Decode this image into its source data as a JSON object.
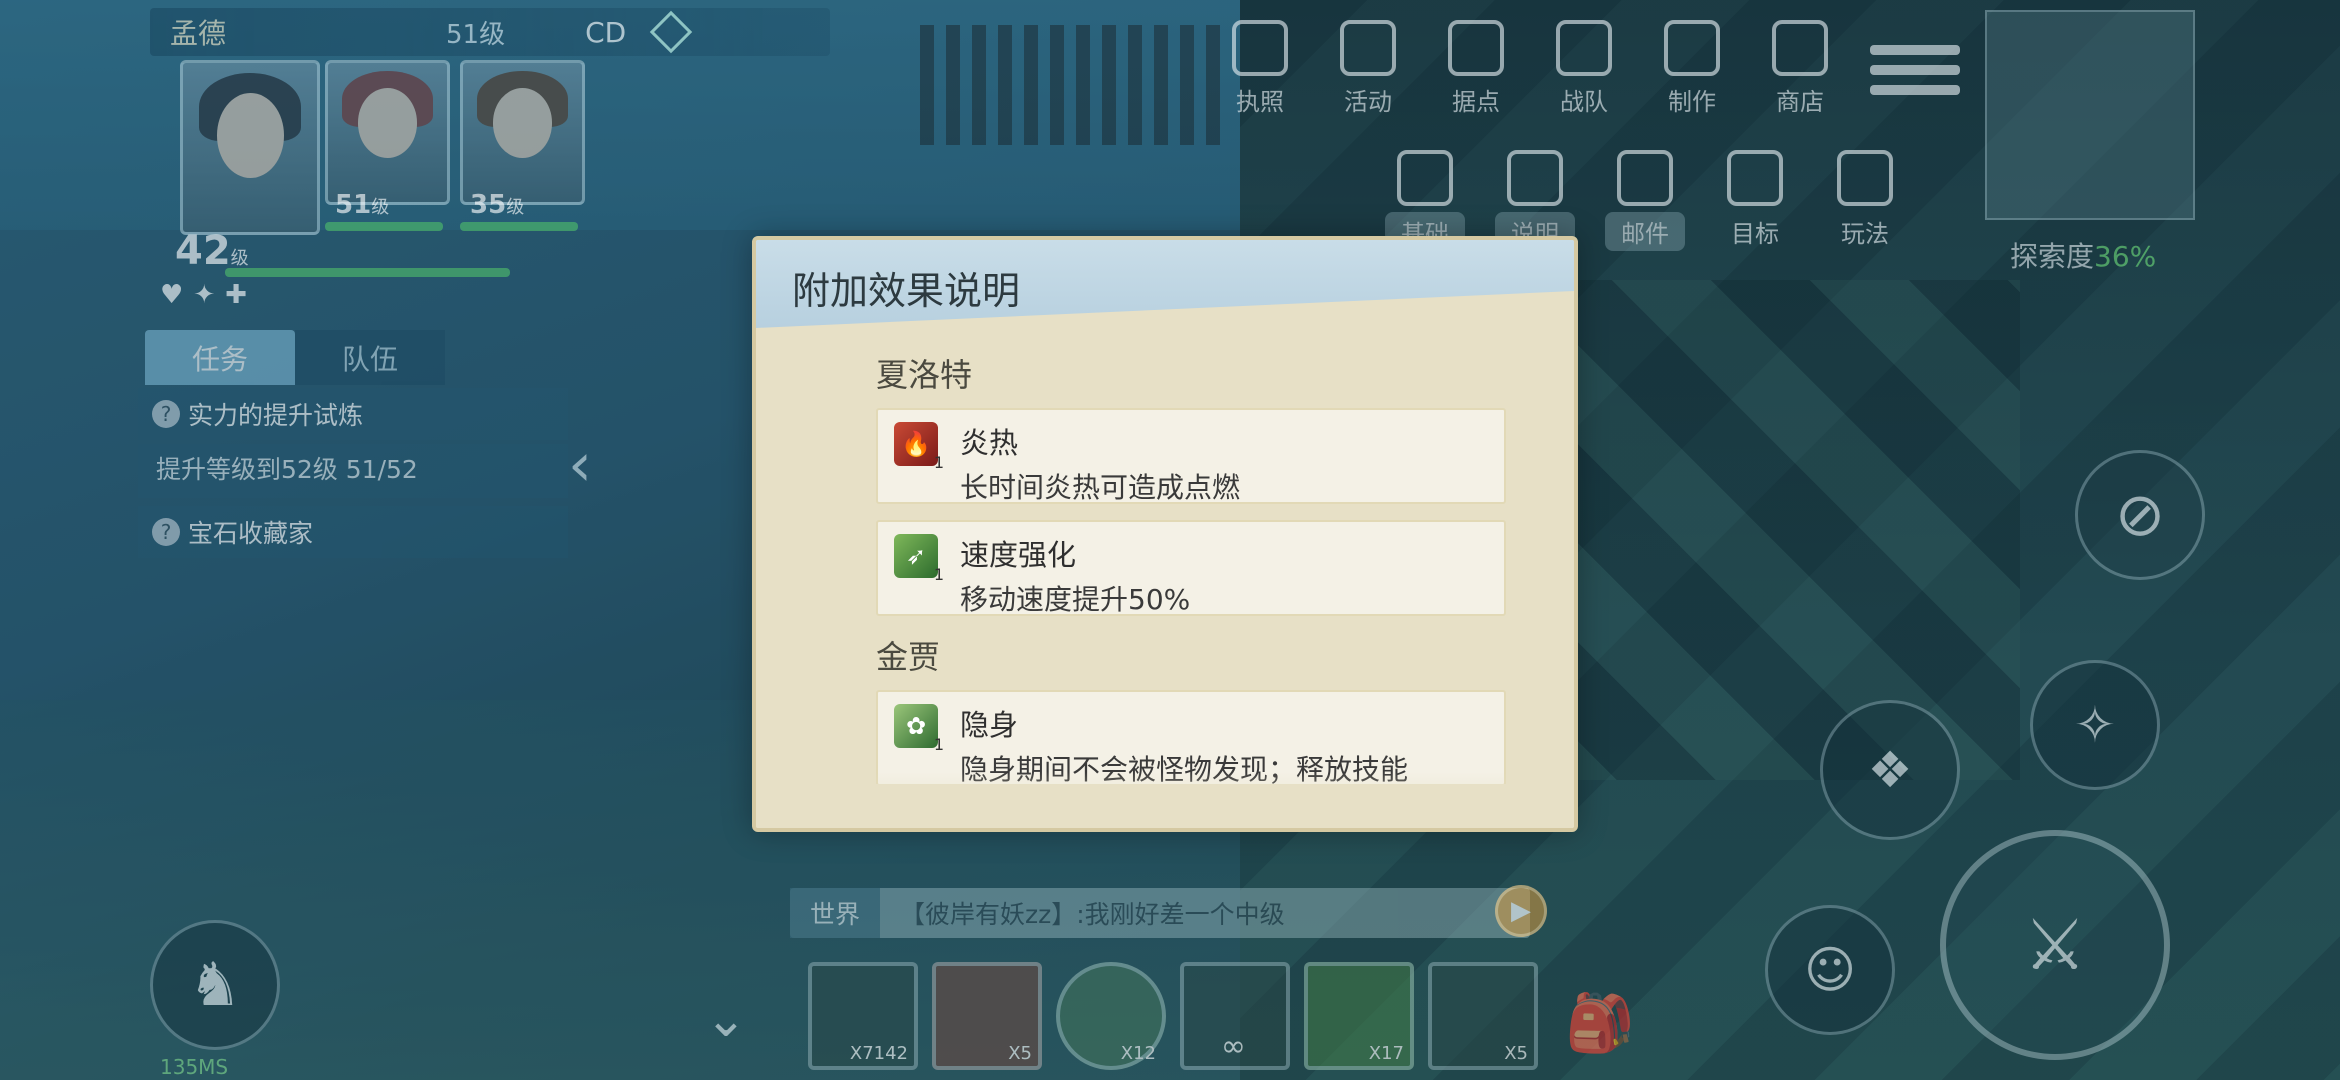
{
  "player": {
    "name": "孟德",
    "level_label": "51级",
    "signal": "CD",
    "ping": "135MS"
  },
  "party": {
    "main_level": "42",
    "main_level_unit": "级",
    "member2_level": "51",
    "member2_unit": "级",
    "member3_level": "35",
    "member3_unit": "级"
  },
  "tabs": {
    "task": "任务",
    "team": "队伍"
  },
  "quests": [
    {
      "title": "实力的提升试炼",
      "progress": "提升等级到52级  51/52"
    },
    {
      "title": "宝石收藏家"
    }
  ],
  "top_menu": [
    "执照",
    "活动",
    "据点",
    "战队",
    "制作",
    "商店"
  ],
  "second_menu": [
    "基础",
    "说明",
    "邮件",
    "目标",
    "玩法"
  ],
  "explore": {
    "label": "探索度",
    "value": "36%"
  },
  "chat": {
    "channel": "世界",
    "message": "【彼岸有妖zz】:我刚好差一个中级"
  },
  "hotbar": [
    "X7142",
    "X5",
    "X12",
    "∞",
    "X17",
    "X5"
  ],
  "dialog": {
    "title": "附加效果说明",
    "sections": [
      {
        "name": "夏洛特",
        "effects": [
          {
            "name": "炎热",
            "desc": "长时间炎热可造成点燃",
            "icon": "fire-icon",
            "count": "1"
          },
          {
            "name": "速度强化",
            "desc": "移动速度提升50%",
            "icon": "speed-icon",
            "count": "1"
          }
        ]
      },
      {
        "name": "金贾",
        "effects": [
          {
            "name": "隐身",
            "desc": "隐身期间不会被怪物发现；释放技能",
            "icon": "stealth-icon",
            "count": "1"
          }
        ]
      }
    ]
  },
  "colors": {
    "dialog_bg": "#e7e0c6",
    "header": "#c9dde8",
    "accent_green": "#6ddb7a"
  }
}
